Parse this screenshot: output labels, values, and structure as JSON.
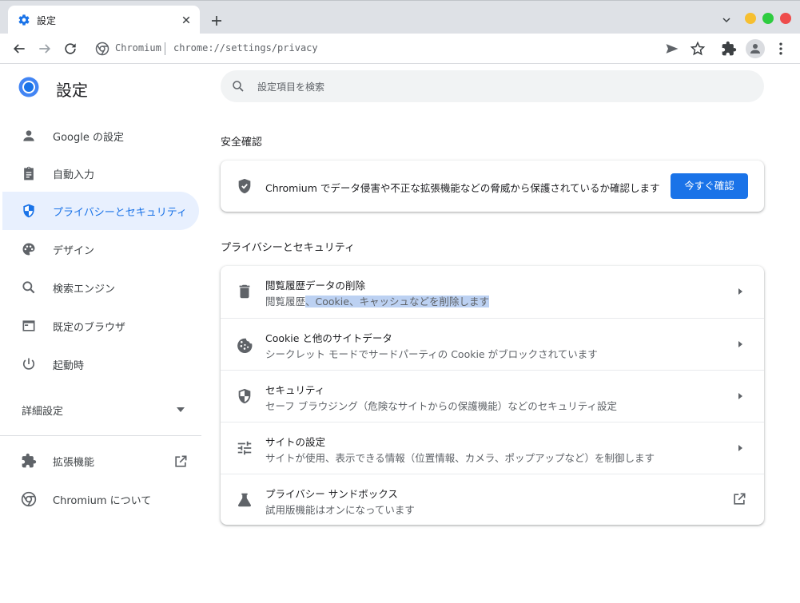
{
  "tab": {
    "title": "設定",
    "icon": "gear-icon"
  },
  "window_controls": {
    "minimize": "#f6bf30",
    "maximize": "#2ecc40",
    "close": "#ee4c4c"
  },
  "toolbar": {
    "site_name": "Chromium",
    "url": "chrome://settings/privacy"
  },
  "settings": {
    "title": "設定",
    "search_placeholder": "設定項目を検索"
  },
  "sidebar": {
    "items": [
      {
        "label": "Google の設定",
        "icon": "person-icon"
      },
      {
        "label": "自動入力",
        "icon": "clipboard-icon"
      },
      {
        "label": "プライバシーとセキュリティ",
        "icon": "shield-icon",
        "active": true
      },
      {
        "label": "デザイン",
        "icon": "palette-icon"
      },
      {
        "label": "検索エンジン",
        "icon": "search-icon"
      },
      {
        "label": "既定のブラウザ",
        "icon": "browser-icon"
      },
      {
        "label": "起動時",
        "icon": "power-icon"
      }
    ],
    "advanced_label": "詳細設定",
    "extensions_label": "拡張機能",
    "about_label": "Chromium について"
  },
  "safety_check": {
    "section_title": "安全確認",
    "text": "Chromium でデータ侵害や不正な拡張機能などの脅威から保護されているか確認します",
    "button_label": "今すぐ確認"
  },
  "privacy": {
    "section_title": "プライバシーとセキュリティ",
    "rows": [
      {
        "title": "閲覧履歴データの削除",
        "subtitle_a": "閲覧履歴",
        "subtitle_b": "、Cookie、キャッシュなどを削除します",
        "icon": "trash-icon"
      },
      {
        "title": "Cookie と他のサイトデータ",
        "subtitle": "シークレット モードでサードパーティの Cookie がブロックされています",
        "icon": "cookie-icon"
      },
      {
        "title": "セキュリティ",
        "subtitle": "セーフ ブラウジング（危険なサイトからの保護機能）などのセキュリティ設定",
        "icon": "shield-icon"
      },
      {
        "title": "サイトの設定",
        "subtitle": "サイトが使用、表示できる情報（位置情報、カメラ、ポップアップなど）を制御します",
        "icon": "sliders-icon"
      },
      {
        "title": "プライバシー サンドボックス",
        "subtitle": "試用版機能はオンになっています",
        "icon": "flask-icon"
      }
    ]
  }
}
